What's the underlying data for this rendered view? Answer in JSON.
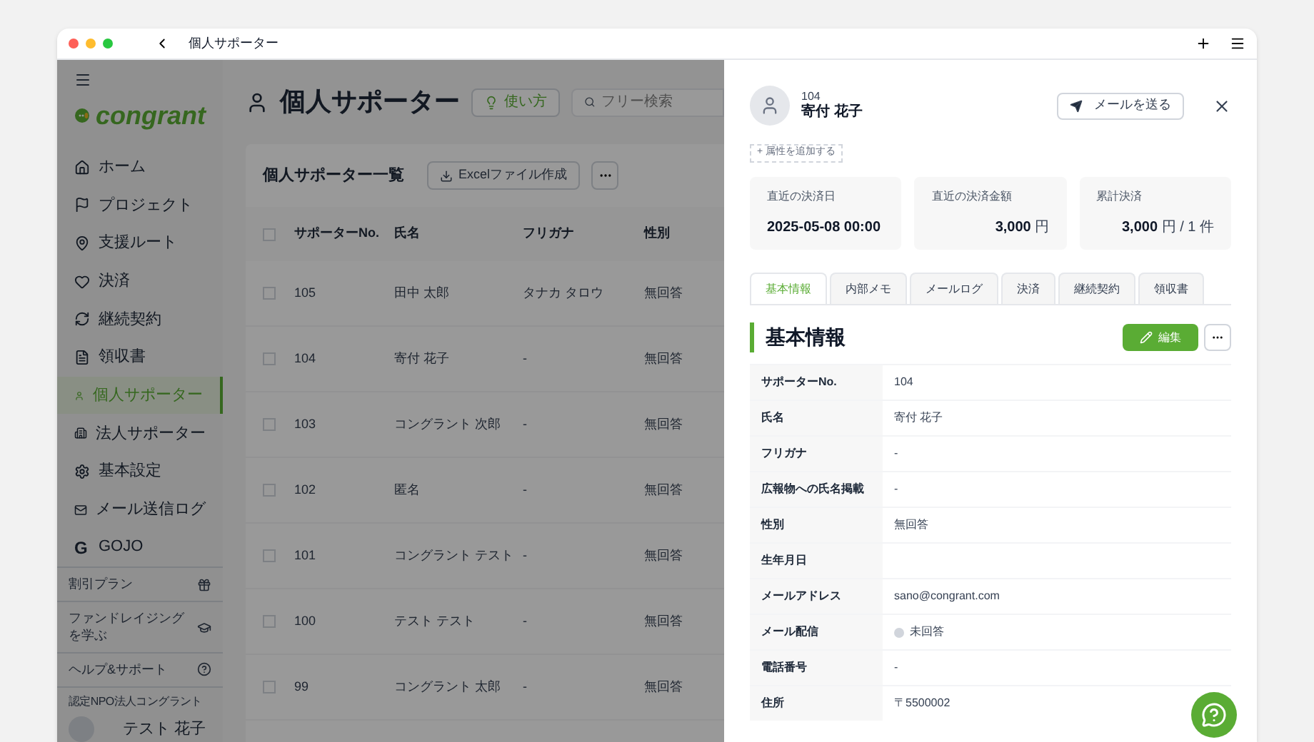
{
  "window": {
    "title": "個人サポーター"
  },
  "sidebar": {
    "logo": "congrant",
    "menu_items": [
      {
        "label": "ホーム",
        "selected": false
      },
      {
        "label": "プロジェクト",
        "selected": false
      },
      {
        "label": "支援ルート",
        "selected": false
      },
      {
        "label": "決済",
        "selected": false
      },
      {
        "label": "継続契約",
        "selected": false
      },
      {
        "label": "領収書",
        "selected": false
      },
      {
        "label": "個人サポーター",
        "selected": true
      },
      {
        "label": "法人サポーター",
        "selected": false
      },
      {
        "label": "基本設定",
        "selected": false
      },
      {
        "label": "メール送信ログ",
        "selected": false
      },
      {
        "label": "GOJO",
        "selected": false,
        "glyph": "G"
      }
    ],
    "extras": [
      {
        "label": "割引プラン"
      },
      {
        "label": "ファンドレイジングを学ぶ"
      },
      {
        "label": "ヘルプ&サポート"
      }
    ],
    "org": "認定NPO法人コングラント",
    "user": "テスト 花子"
  },
  "main": {
    "title": "個人サポーター",
    "help_button": "使い方",
    "search": {
      "placeholder": "フリー検索"
    },
    "list_title": "個人サポーター一覧",
    "excel_button": "Excelファイル作成",
    "all_checked": false,
    "columns": [
      "サポーターNo.",
      "氏名",
      "フリガナ",
      "性別"
    ],
    "rows": [
      {
        "checked": false,
        "no": "105",
        "name": "田中 太郎",
        "kana": "タナカ タロウ",
        "gender": "無回答"
      },
      {
        "checked": false,
        "no": "104",
        "name": "寄付 花子",
        "kana": "-",
        "gender": "無回答"
      },
      {
        "checked": false,
        "no": "103",
        "name": "コングラント 次郎",
        "kana": "-",
        "gender": "無回答"
      },
      {
        "checked": false,
        "no": "102",
        "name": "匿名",
        "kana": "-",
        "gender": "無回答"
      },
      {
        "checked": false,
        "no": "101",
        "name": "コングラント テスト",
        "kana": "-",
        "gender": "無回答"
      },
      {
        "checked": false,
        "no": "100",
        "name": "テスト テスト",
        "kana": "-",
        "gender": "無回答"
      },
      {
        "checked": false,
        "no": "99",
        "name": "コングラント 太郎",
        "kana": "-",
        "gender": "無回答"
      }
    ]
  },
  "panel": {
    "number": "104",
    "name": "寄付 花子",
    "mail_button": "メールを送る",
    "add_attribute": "+ 属性を追加する",
    "stats": [
      {
        "label": "直近の決済日",
        "value": "2025-05-08 00:00"
      },
      {
        "label": "直近の決済金額",
        "value": "3,000",
        "unit": "円"
      },
      {
        "label": "累計決済",
        "value": "3,000",
        "unit": "円 / 1 件"
      }
    ],
    "tabs": [
      {
        "label": "基本情報",
        "selected": true
      },
      {
        "label": "内部メモ",
        "selected": false
      },
      {
        "label": "メールログ",
        "selected": false
      },
      {
        "label": "決済",
        "selected": false
      },
      {
        "label": "継続契約",
        "selected": false
      },
      {
        "label": "領収書",
        "selected": false
      }
    ],
    "section_title": "基本情報",
    "edit_button": "編集",
    "fields": [
      {
        "label": "サポーターNo.",
        "value": "104"
      },
      {
        "label": "氏名",
        "value": "寄付 花子"
      },
      {
        "label": "フリガナ",
        "value": "-"
      },
      {
        "label": "広報物への氏名掲載",
        "value": "-"
      },
      {
        "label": "性別",
        "value": "無回答"
      },
      {
        "label": "生年月日"
      },
      {
        "label": "メールアドレス",
        "value": "sano@congrant.com"
      },
      {
        "label": "メール配信",
        "value": "未回答",
        "kind": "status"
      },
      {
        "label": "電話番号",
        "value": "-"
      },
      {
        "label": "住所",
        "value": "〒5500002"
      }
    ]
  }
}
